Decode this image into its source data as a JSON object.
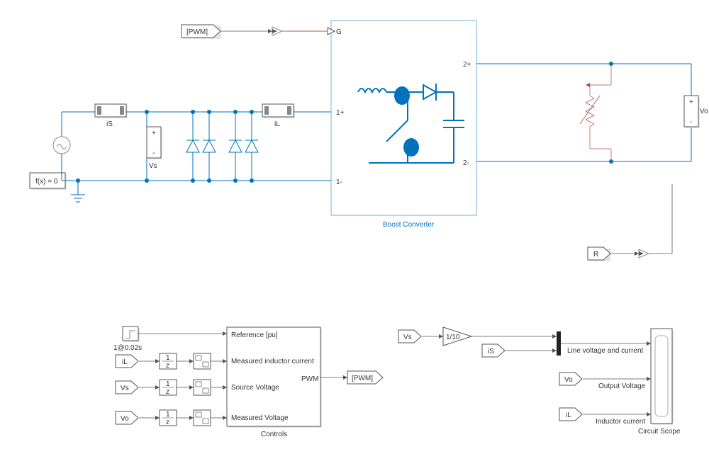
{
  "blocks": {
    "pwm_from": "[PWM]",
    "g_port": "G",
    "solver": "f(x) = 0",
    "iS_label": "iS",
    "Vs_label": "Vs",
    "iL_label": "iL",
    "port_1plus": "1+",
    "port_1minus": "1-",
    "port_2plus": "2+",
    "port_2minus": "2-",
    "Vo_label": "Vo",
    "boost_converter": "Boost Converter",
    "R_from": "R",
    "step_label": "1@0.02s",
    "controls": {
      "ref": "Reference [pu]",
      "meas_ind": "Measured inductor current",
      "src_v": "Source Voltage",
      "meas_v": "Measured Voltage",
      "pwm_out": "PWM",
      "title": "Controls"
    },
    "from_iL": "iL",
    "from_Vs": "Vs",
    "from_Vo": "Vo",
    "delay_text": "1",
    "delay_den": "z",
    "pwm_goto": "[PWM]",
    "scope": {
      "from_Vs": "Vs",
      "gain": "1/10",
      "from_iS": "iS",
      "from_Vo": "Vo",
      "from_iL": "iL",
      "line_vi": "Line voltage and current",
      "out_v": "Output Voltage",
      "ind_i": "Inductor current",
      "title": "Circuit Scope"
    }
  },
  "plus": "+",
  "minus": "-"
}
